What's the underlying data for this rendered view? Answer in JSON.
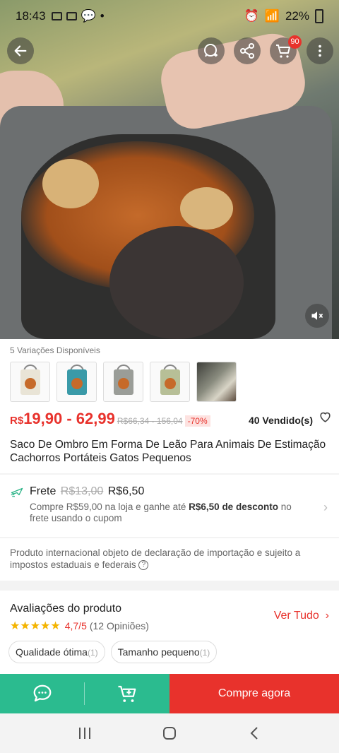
{
  "status": {
    "time": "18:43",
    "battery": "22%"
  },
  "header": {
    "cart_badge": "90"
  },
  "icons": {
    "back": "back-arrow-icon",
    "whatsapp": "whatsapp-icon",
    "share": "share-icon",
    "cart": "cart-icon",
    "more": "more-vertical-icon",
    "mute": "mute-icon",
    "heart": "heart-icon",
    "shipping": "plane-icon",
    "chat": "chat-icon",
    "add_cart": "cart-plus-icon"
  },
  "product": {
    "variations_label": "5 Variações Disponíveis",
    "variation_colors": [
      "#e9e4d6",
      "#3a9aa8",
      "#9a9d98",
      "#b7bf97"
    ],
    "price_currency": "R$",
    "price_range": "19,90 - 62,99",
    "old_price": "R$66,34 - 156,04",
    "discount": "-70%",
    "sold": "40 Vendido(s)",
    "title": "Saco De Ombro Em Forma De Leão Para Animais De Estimação Cachorros Portáteis Gatos Pequenos"
  },
  "shipping": {
    "label": "Frete",
    "old": "R$13,00",
    "new": "R$6,50",
    "desc_prefix": "Compre R$59,00 na loja e ganhe até ",
    "desc_bold": "R$6,50 de desconto",
    "desc_suffix": " no frete usando o cupom"
  },
  "import_note": "Produto internacional objeto de declaração de importação e sujeito a impostos estaduais e federais",
  "reviews": {
    "title": "Avaliações do produto",
    "stars": "★★★★★",
    "rating": "4,7/5",
    "count": "(12 Opiniões)",
    "see_all": "Ver Tudo",
    "tags": [
      {
        "label": "Qualidade ótima",
        "n": "(1)"
      },
      {
        "label": "Tamanho pequeno",
        "n": "(1)"
      }
    ]
  },
  "actions": {
    "buy_now": "Compre agora"
  },
  "colors": {
    "accent_red": "#e8322c",
    "accent_green": "#2bbb8f"
  }
}
